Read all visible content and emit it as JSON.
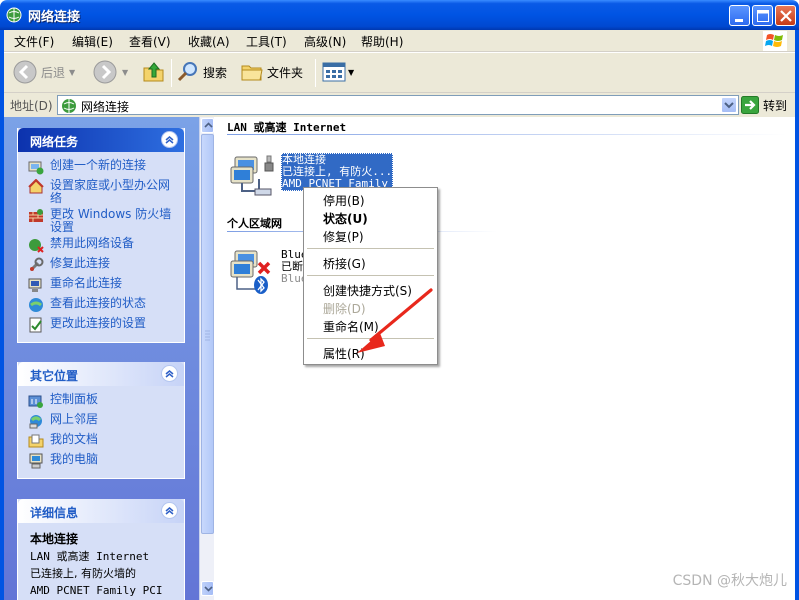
{
  "window": {
    "title": "网络连接",
    "controls": [
      "minimize-icon",
      "maximize-icon",
      "close-icon"
    ]
  },
  "menubar": [
    "文件(F)",
    "编辑(E)",
    "查看(V)",
    "收藏(A)",
    "工具(T)",
    "高级(N)",
    "帮助(H)"
  ],
  "toolbar": {
    "back": "后退",
    "search": "搜索",
    "folders": "文件夹"
  },
  "address": {
    "label": "地址(D)",
    "value": "网络连接",
    "go": "转到"
  },
  "left_pane": {
    "network_tasks": {
      "title": "网络任务",
      "items": [
        {
          "label": "创建一个新的连接",
          "icon": "new-connection-icon"
        },
        {
          "label": "设置家庭或小型办公网络",
          "icon": "home-network-icon"
        },
        {
          "label": "更改 Windows 防火墙设置",
          "icon": "firewall-icon"
        },
        {
          "label": "禁用此网络设备",
          "icon": "disable-device-icon"
        },
        {
          "label": "修复此连接",
          "icon": "repair-icon"
        },
        {
          "label": "重命名此连接",
          "icon": "rename-icon"
        },
        {
          "label": "查看此连接的状态",
          "icon": "status-icon"
        },
        {
          "label": "更改此连接的设置",
          "icon": "settings-icon"
        }
      ]
    },
    "other_places": {
      "title": "其它位置",
      "items": [
        {
          "label": "控制面板",
          "icon": "control-panel-icon"
        },
        {
          "label": "网上邻居",
          "icon": "network-places-icon"
        },
        {
          "label": "我的文档",
          "icon": "my-documents-icon"
        },
        {
          "label": "我的电脑",
          "icon": "my-computer-icon"
        }
      ]
    },
    "details": {
      "title": "详细信息",
      "name": "本地连接",
      "line1": "LAN 或高速 Internet",
      "line2": "已连接上, 有防火墙的",
      "line3": "AMD PCNET Family PCI"
    }
  },
  "main": {
    "group_lan": "LAN 或高速 Internet",
    "group_pan": "个人区域网",
    "lan_conn": {
      "name": "本地连接",
      "status": "已连接上, 有防火...",
      "device": "AMD PCNET Family"
    },
    "pan_conn": {
      "name": "Blue",
      "status": "已断",
      "device": "Blue"
    }
  },
  "context_menu": {
    "items": [
      {
        "label": "停用(B)",
        "style": "normal"
      },
      {
        "label": "状态(U)",
        "style": "bold"
      },
      {
        "label": "修复(P)",
        "style": "normal"
      },
      {
        "label": "桥接(G)",
        "style": "normal"
      },
      {
        "label": "创建快捷方式(S)",
        "style": "normal"
      },
      {
        "label": "删除(D)",
        "style": "disabled"
      },
      {
        "label": "重命名(M)",
        "style": "normal"
      },
      {
        "label": "属性(R)",
        "style": "normal"
      }
    ]
  },
  "watermark": "CSDN @秋大炮儿",
  "colors": {
    "title_bar": "#0054e3",
    "selection": "#316ac5",
    "link": "#215dc6",
    "arrow": "#e8281c"
  }
}
